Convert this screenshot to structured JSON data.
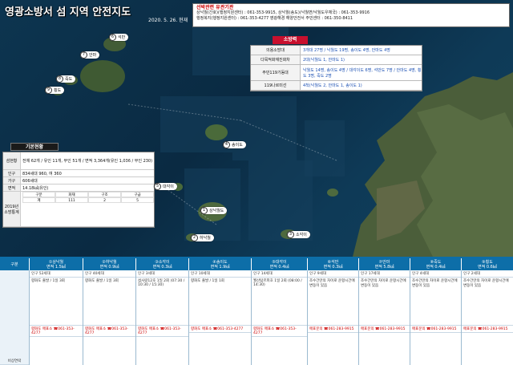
{
  "title": "영광소방서 섬 지역 안전지도",
  "date": "2020. 5. 26. 현재",
  "contact": {
    "title": "선박관련 유관기관",
    "line1": "상낙월(간호)(행정지원센터) : 061-353-9915, 상낙월(송도)(낙월면/낙월도우체국) : 061-353-9916",
    "line2": "행정복지(행정지원센터) : 061-353-4277  영광해경 해양안전서 주민센터 : 061-350-8411"
  },
  "fire_station": {
    "title": "소방력",
    "rows": [
      {
        "key": "의용소방대",
        "value": "3개대 27명 / 낙월도 19명, 송이도 4명, 안마도 4명"
      },
      {
        "key": "다목적화재진화차",
        "value": "2대(낙월도 1, 안마도 1)"
      },
      {
        "key": "주민119기동대",
        "value": "낙월도 14명, 송이도 4명 / 대각이도 6명, 석만도 7명 / 안마도 4명, 횡도 3명, 죽도 2명"
      },
      {
        "key": "119나르미선",
        "value": "4척(낙월도 2, 안마도 1, 송이도 1)"
      }
    ]
  },
  "basic_status": {
    "title": "기본현황",
    "rows": [
      {
        "key": "섬현황",
        "value": "전체 62개 / 유인 11개, 무인 51개 / 면적 3,364개(유인 1,036 / 무인 230)"
      },
      {
        "key": "인구",
        "value": "834세대 960, 여 360"
      },
      {
        "key": "가구",
        "value": "606세대"
      },
      {
        "key": "면적",
        "value": "14.18㎢(유인)"
      }
    ],
    "stats_label": "2019년 소방통계",
    "stats": [
      "구분",
      "화재",
      "구조",
      "구급",
      "계",
      "111",
      "2",
      "5",
      "104",
      "",
      "",
      "",
      ""
    ]
  },
  "islands": [
    {
      "num": "1",
      "name": "상낙월도"
    },
    {
      "num": "2",
      "name": "하낙월"
    },
    {
      "num": "3",
      "name": "소각이"
    },
    {
      "num": "4",
      "name": "송이도"
    },
    {
      "num": "5",
      "name": "대각이"
    },
    {
      "num": "6",
      "name": "석만"
    },
    {
      "num": "7",
      "name": "안마"
    },
    {
      "num": "8",
      "name": "죽도"
    },
    {
      "num": "9",
      "name": "횡도"
    }
  ],
  "bottom": {
    "header_label": "구분",
    "columns": [
      {
        "name": "①상낙월",
        "sub": "면적 1.5㎢",
        "info": "인구 52세대"
      },
      {
        "name": "②하낙월",
        "sub": "면적 0.9㎢",
        "info": "인구 40세대"
      },
      {
        "name": "③소각이",
        "sub": "면적 0.3㎢",
        "info": "인구 3세대"
      },
      {
        "name": "④송이도",
        "sub": "면적 1.9㎢",
        "info": "인구 10세대"
      },
      {
        "name": "⑤대각이",
        "sub": "면적 0.4㎢",
        "info": "인구 14세대"
      },
      {
        "name": "⑥석만",
        "sub": "면적 0.3㎢",
        "info": "인구 9세대"
      },
      {
        "name": "⑦안마",
        "sub": "면적 5.8㎢",
        "info": "인구 17세대"
      },
      {
        "name": "⑧죽도",
        "sub": "면적 0.4㎢",
        "info": "인구 4세대"
      },
      {
        "name": "⑨횡도",
        "sub": "면적 0.6㎢",
        "info": "인구 2세대"
      }
    ],
    "ferry": [
      "향화도 출발 / 1일 3회",
      "향화도 출발 / 1일 3회",
      "섬사랑12호 1일 2회 (07:30 / 10:30 / 15:30)",
      "향화도 출발 / 1일 1회",
      "월산탐르피호 1일 2회 (08:00 / 14:30)",
      "조수간만의 차이로 운항시간에 변동이 있음",
      "조수간만의 차이로 운항시간에 변동이 있음",
      "조수간만의 차이로 운항시간에 변동이 있음",
      "조수간만의 차이로 운항시간에 변동이 있음"
    ],
    "phone": [
      "향화도 매표소 ☎061-353-4277",
      "향화도 매표소 ☎061-353-4277",
      "향화도 매표소 ☎061-353-4277",
      "향화도 매표소 ☎061-353-4277",
      "향화도 매표소 ☎061-353-4277",
      "매표문의 ☎061-283-9915",
      "매표문의 ☎061-283-9915",
      "매표문의 ☎061-283-9915",
      "매표문의 ☎061-283-9915"
    ],
    "contact_label": "비상연락"
  }
}
